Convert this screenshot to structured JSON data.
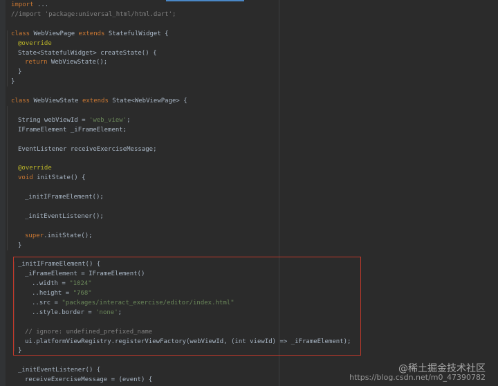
{
  "lines": [
    {
      "indent": 0,
      "tokens": [
        {
          "t": "import",
          "c": "kw"
        },
        {
          "t": " ...",
          "c": "id"
        }
      ]
    },
    {
      "indent": 0,
      "tokens": [
        {
          "t": "//import 'package:universal_html/html.dart';",
          "c": "cm"
        }
      ]
    },
    {
      "indent": 0,
      "tokens": []
    },
    {
      "indent": 0,
      "tokens": [
        {
          "t": "class",
          "c": "kw"
        },
        {
          "t": " WebViewPage ",
          "c": "id"
        },
        {
          "t": "extends",
          "c": "kw"
        },
        {
          "t": " StatefulWidget {",
          "c": "id"
        }
      ]
    },
    {
      "indent": 1,
      "tokens": [
        {
          "t": "@override",
          "c": "ann"
        }
      ]
    },
    {
      "indent": 1,
      "tokens": [
        {
          "t": "State<StatefulWidget> createState() {",
          "c": "id"
        }
      ]
    },
    {
      "indent": 2,
      "tokens": [
        {
          "t": "return",
          "c": "kw"
        },
        {
          "t": " WebViewState();",
          "c": "id"
        }
      ]
    },
    {
      "indent": 1,
      "tokens": [
        {
          "t": "}",
          "c": "id"
        }
      ]
    },
    {
      "indent": 0,
      "tokens": [
        {
          "t": "}",
          "c": "id"
        }
      ]
    },
    {
      "indent": 0,
      "tokens": []
    },
    {
      "indent": 0,
      "tokens": [
        {
          "t": "class",
          "c": "kw"
        },
        {
          "t": " WebViewState ",
          "c": "id"
        },
        {
          "t": "extends",
          "c": "kw"
        },
        {
          "t": " State<WebViewPage> {",
          "c": "id"
        }
      ]
    },
    {
      "indent": 0,
      "tokens": []
    },
    {
      "indent": 1,
      "tokens": [
        {
          "t": "String webViewId = ",
          "c": "id"
        },
        {
          "t": "'web_view'",
          "c": "str"
        },
        {
          "t": ";",
          "c": "id"
        }
      ]
    },
    {
      "indent": 1,
      "tokens": [
        {
          "t": "IFrameElement _iFrameElement;",
          "c": "id"
        }
      ]
    },
    {
      "indent": 0,
      "tokens": []
    },
    {
      "indent": 1,
      "tokens": [
        {
          "t": "EventListener receiveExerciseMessage;",
          "c": "id"
        }
      ]
    },
    {
      "indent": 0,
      "tokens": []
    },
    {
      "indent": 1,
      "tokens": [
        {
          "t": "@override",
          "c": "ann"
        }
      ]
    },
    {
      "indent": 1,
      "tokens": [
        {
          "t": "void",
          "c": "kw"
        },
        {
          "t": " initState() {",
          "c": "id"
        }
      ]
    },
    {
      "indent": 0,
      "tokens": []
    },
    {
      "indent": 2,
      "tokens": [
        {
          "t": "_initIFrameElement();",
          "c": "id"
        }
      ]
    },
    {
      "indent": 0,
      "tokens": []
    },
    {
      "indent": 2,
      "tokens": [
        {
          "t": "_initEventListener();",
          "c": "id"
        }
      ]
    },
    {
      "indent": 0,
      "tokens": []
    },
    {
      "indent": 2,
      "tokens": [
        {
          "t": "super",
          "c": "kw"
        },
        {
          "t": ".initState();",
          "c": "id"
        }
      ]
    },
    {
      "indent": 1,
      "tokens": [
        {
          "t": "}",
          "c": "id"
        }
      ]
    },
    {
      "indent": 0,
      "tokens": []
    },
    {
      "indent": 1,
      "tokens": [
        {
          "t": "_initIFrameElement() {",
          "c": "id"
        }
      ]
    },
    {
      "indent": 2,
      "tokens": [
        {
          "t": "_iFrameElement = IFrameElement()",
          "c": "id"
        }
      ]
    },
    {
      "indent": 3,
      "tokens": [
        {
          "t": "..width = ",
          "c": "id"
        },
        {
          "t": "\"1024\"",
          "c": "str"
        }
      ]
    },
    {
      "indent": 3,
      "tokens": [
        {
          "t": "..height = ",
          "c": "id"
        },
        {
          "t": "\"768\"",
          "c": "str"
        }
      ]
    },
    {
      "indent": 3,
      "tokens": [
        {
          "t": "..src = ",
          "c": "id"
        },
        {
          "t": "\"packages/interact_exercise/editor/index.html\"",
          "c": "str"
        }
      ]
    },
    {
      "indent": 3,
      "tokens": [
        {
          "t": "..style.border = ",
          "c": "id"
        },
        {
          "t": "'none'",
          "c": "str"
        },
        {
          "t": ";",
          "c": "id"
        }
      ]
    },
    {
      "indent": 0,
      "tokens": []
    },
    {
      "indent": 2,
      "tokens": [
        {
          "t": "// ignore: undefined_prefixed_name",
          "c": "cm"
        }
      ]
    },
    {
      "indent": 2,
      "tokens": [
        {
          "t": "ui.platformViewRegistry.registerViewFactory(webViewId, (int viewId) => _iFrameElement);",
          "c": "id"
        }
      ]
    },
    {
      "indent": 1,
      "tokens": [
        {
          "t": "}",
          "c": "id"
        }
      ]
    },
    {
      "indent": 0,
      "tokens": []
    },
    {
      "indent": 1,
      "tokens": [
        {
          "t": "_initEventListener() {",
          "c": "id"
        }
      ]
    },
    {
      "indent": 2,
      "tokens": [
        {
          "t": "receiveExerciseMessage = (event) {",
          "c": "id"
        }
      ]
    }
  ],
  "watermark": {
    "line1": "@稀土掘金技术社区",
    "line2": "https://blog.csdn.net/m0_47390782"
  },
  "colors": {
    "background": "#2b2b2b",
    "keyword": "#cc7832",
    "comment": "#808080",
    "string": "#6a8759",
    "annotation": "#bbb529",
    "identifier": "#a9b7c6",
    "highlight_border": "#c0392b"
  }
}
